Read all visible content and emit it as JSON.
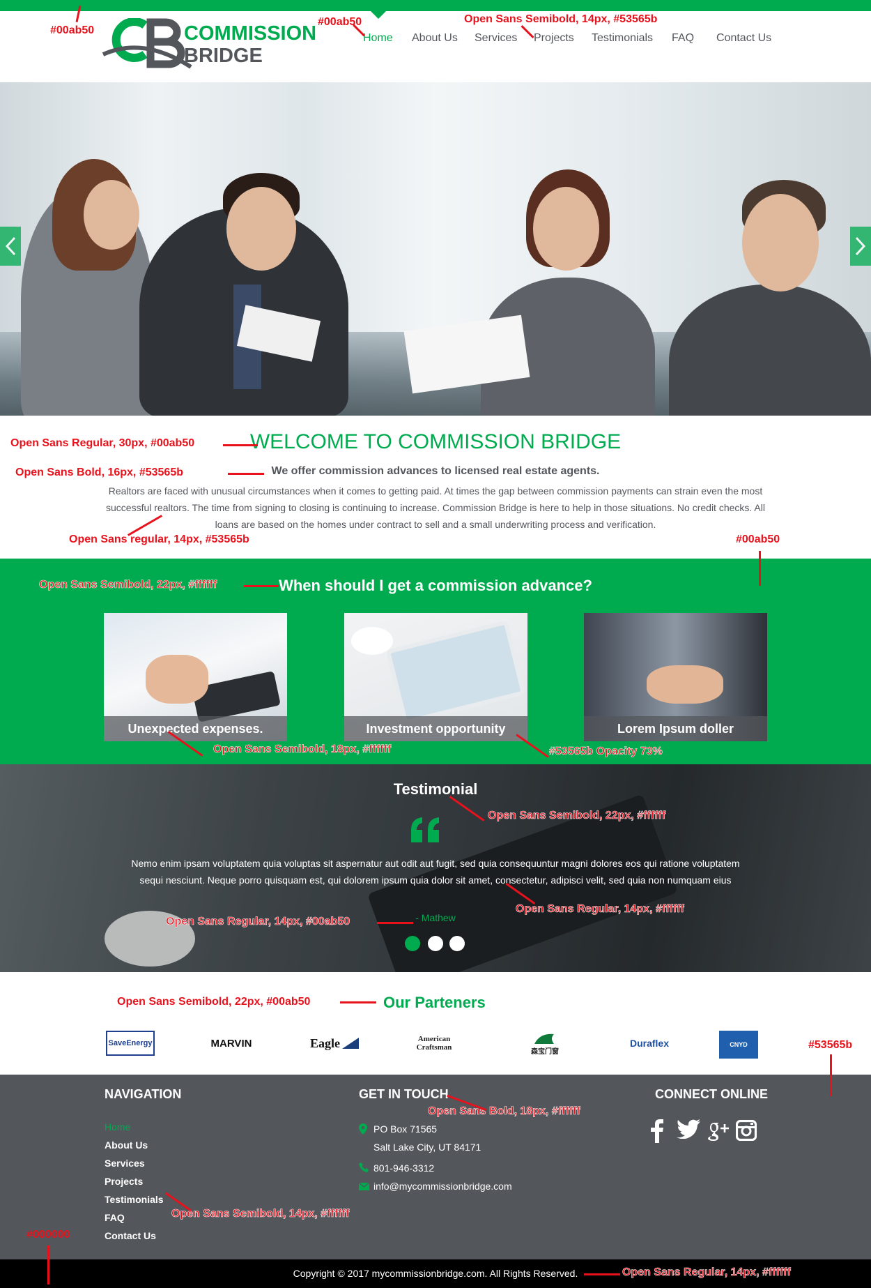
{
  "brand": {
    "logo_line1": "COMMISSION",
    "logo_line2": "BRIDGE",
    "green": "#00ab50",
    "gray": "#53565b"
  },
  "nav": {
    "items": [
      "Home",
      "About Us",
      "Services",
      "Projects",
      "Testimonials",
      "FAQ",
      "Contact Us"
    ],
    "active": "Home"
  },
  "welcome": {
    "title": "WELCOME TO COMMISSION BRIDGE",
    "subtitle": "We offer commission advances to licensed real estate agents.",
    "body": "Realtors are faced with unusual circumstances when it comes to getting paid. At times the gap between commission payments can strain even the most successful realtors. The time from signing to closing is continuing to increase. Commission Bridge is here to help in those situations. No credit checks. All loans are based on the homes under contract to sell and a small underwriting process and verification."
  },
  "advance": {
    "title": "When should I get a commission advance?",
    "cards": [
      "Unexpected expenses.",
      "Investment opportunity",
      "Lorem Ipsum doller"
    ]
  },
  "testimonial": {
    "title": "Testimonial",
    "quote": "Nemo enim ipsam voluptatem quia voluptas sit aspernatur aut odit aut fugit, sed quia consequuntur magni dolores eos qui ratione voluptatem sequi nesciunt. Neque porro quisquam est, qui dolorem ipsum quia dolor sit amet, consectetur, adipisci velit, sed quia non numquam eius",
    "author": "- Mathew"
  },
  "partners": {
    "title": "Our Parteners",
    "logos": [
      "SaveEnergy",
      "MARVIN",
      "Eagle",
      "American Craftsman",
      "森宝门窗",
      "Duraflex",
      "CNYD"
    ]
  },
  "footer": {
    "nav_title": "NAVIGATION",
    "nav_items": [
      "Home",
      "About Us",
      "Services",
      "Projects",
      "Testimonials",
      "FAQ",
      "Contact Us"
    ],
    "touch_title": "GET IN TOUCH",
    "address1": "PO Box 71565",
    "address2": "Salt Lake City, UT 84171",
    "phone": "801-946-3312",
    "email": "info@mycommissionbridge.com",
    "connect_title": "CONNECT ONLINE",
    "social": [
      "facebook-icon",
      "twitter-icon",
      "google-plus-icon",
      "instagram-icon"
    ],
    "copyright": "Copyright © 2017 mycommissionbridge.com. All Rights Reserved."
  },
  "annotations": {
    "a1": "#00ab50",
    "a2": "#00ab50",
    "a3": "Open Sans Semibold, 14px, #53565b",
    "a4": "Open Sans Regular, 30px, #00ab50",
    "a5": "Open Sans Bold, 16px, #53565b",
    "a6": "Open Sans regular, 14px, #53565b",
    "a7": "#00ab50",
    "a8": "Open Sans Semibold, 22px, #ffffff",
    "a9": "Open Sans Semibold, 18px, #ffffff",
    "a10": "#53565b Opacity 73%",
    "a11": "Open Sans Semibold, 22px, #ffffff",
    "a12": "Open Sans Regular, 14px, #ffffff",
    "a13": "Open Sans Regular, 14px, #00ab50",
    "a14": "Open Sans Semibold, 22px, #00ab50",
    "a15": "#53565b",
    "a16": "Open Sans Bold, 18px, #ffffff",
    "a17": "Open Sans Semibold, 14px, #ffffff",
    "a18": "#000000",
    "a19": "Open Sans Regular, 14px, #ffffff"
  }
}
